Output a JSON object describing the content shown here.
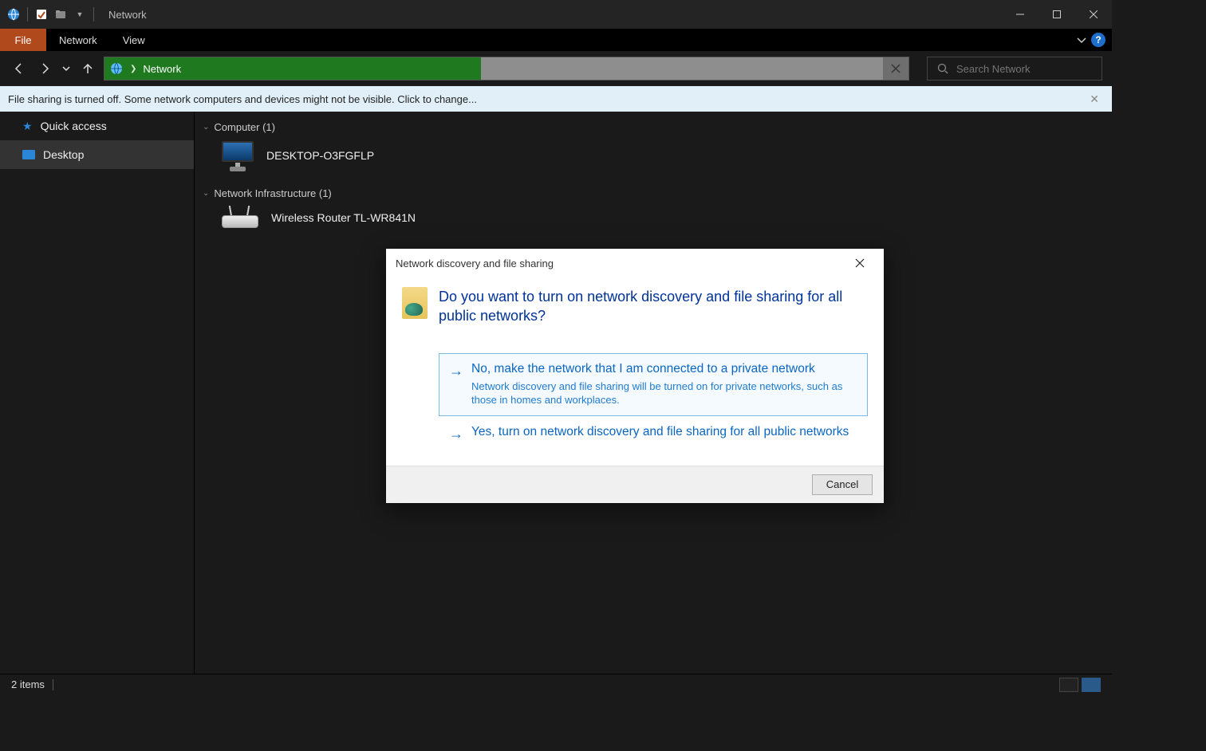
{
  "titlebar": {
    "title": "Network"
  },
  "ribbon": {
    "file": "File",
    "tabs": [
      "Network",
      "View"
    ]
  },
  "addressbar": {
    "location": "Network"
  },
  "search": {
    "placeholder": "Search Network"
  },
  "infobar": {
    "message": "File sharing is turned off. Some network computers and devices might not be visible. Click to change..."
  },
  "sidebar": {
    "items": [
      {
        "label": "Quick access"
      },
      {
        "label": "Desktop"
      }
    ]
  },
  "content": {
    "groups": [
      {
        "header": "Computer (1)",
        "items": [
          {
            "label": "DESKTOP-O3FGFLP"
          }
        ]
      },
      {
        "header": "Network Infrastructure (1)",
        "items": [
          {
            "label": "Wireless Router TL-WR841N"
          }
        ]
      }
    ]
  },
  "statusbar": {
    "count": "2 items"
  },
  "dialog": {
    "title": "Network discovery and file sharing",
    "heading": "Do you want to turn on network discovery and file sharing for all public networks?",
    "options": [
      {
        "title": "No, make the network that I am connected to a private network",
        "sub": "Network discovery and file sharing will be turned on for private networks, such as those in homes and workplaces."
      },
      {
        "title": "Yes, turn on network discovery and file sharing for all public networks",
        "sub": ""
      }
    ],
    "cancel": "Cancel"
  }
}
